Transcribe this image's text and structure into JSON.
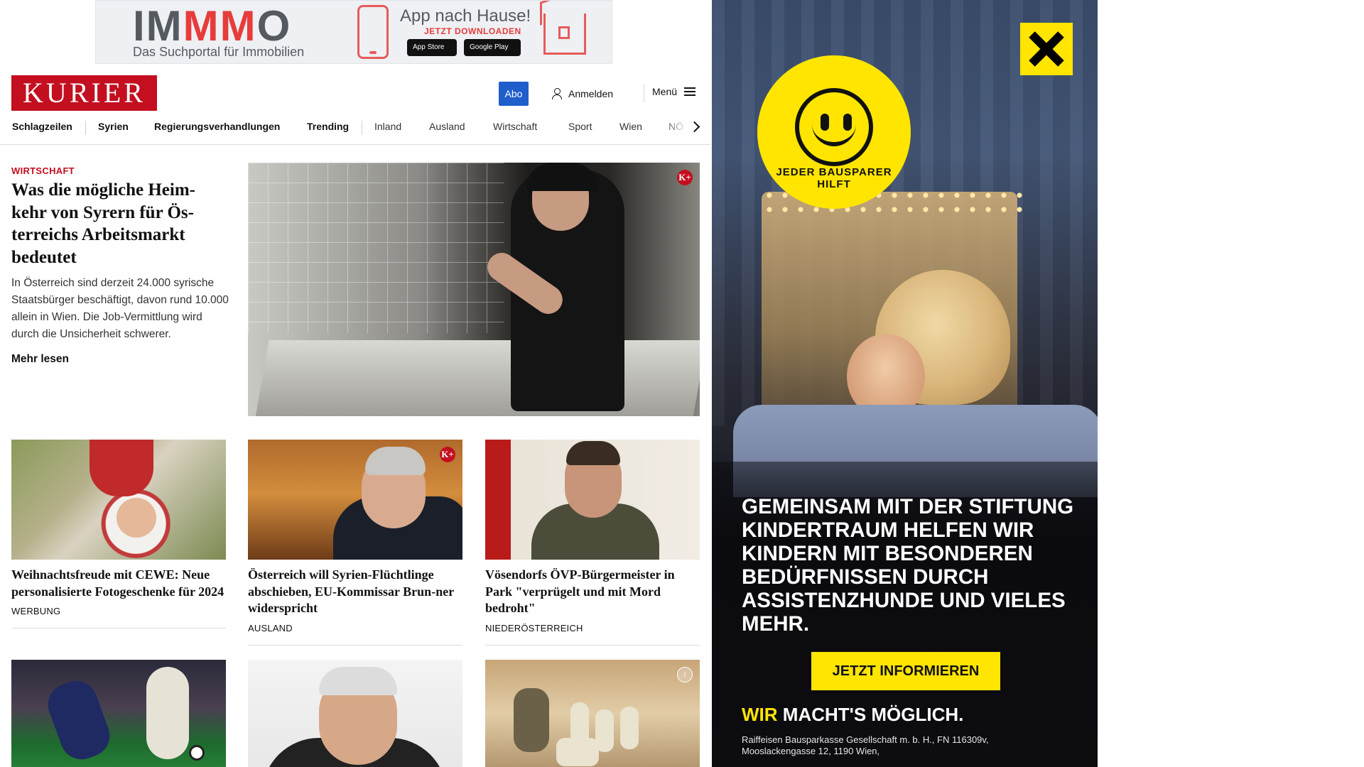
{
  "top_ad": {
    "logo_left": "IM",
    "logo_mid": "MM",
    "logo_right": "O",
    "tagline": "Das Suchportal für Immobilien",
    "headline": "App nach Hause!",
    "subline": "JETZT DOWNLOADEN",
    "app_store_label": "App Store",
    "google_play_label": "Google Play"
  },
  "header": {
    "logo": "KURIER",
    "abo": "Abo",
    "login": "Anmelden",
    "menu": "Menü"
  },
  "nav": {
    "items": [
      "Schlagzeilen",
      "Syrien",
      "Regierungsverhandlungen",
      "Trending",
      "Inland",
      "Ausland",
      "Wirtschaft",
      "Sport",
      "Wien",
      "NÖ"
    ]
  },
  "lead": {
    "category": "WIRTSCHAFT",
    "title": "Was die mögliche Heim-kehr von Syrern für Ös-terreichs Arbeitsmarkt bedeutet",
    "summary": "In Österreich sind derzeit 24.000 syrische Staatsbürger beschäftigt, davon rund 10.000 allein in Wien. Die Job-Vermittlung wird durch die Unsicherheit schwerer.",
    "more": "Mehr lesen",
    "badge": "K+"
  },
  "articles": [
    {
      "title": "Weihnachtsfreude mit CEWE: Neue personalisierte Fotogeschenke für 2024",
      "category": "WERBUNG"
    },
    {
      "title": "Österreich will Syrien-Flüchtlinge abschieben, EU-Kommissar Brun-ner widerspricht",
      "category": "AUSLAND",
      "badge": "K+"
    },
    {
      "title": "Vösendorfs ÖVP-Bürgermeister in Park \"verprügelt und mit Mord bedroht\"",
      "category": "NIEDERÖSTERREICH"
    }
  ],
  "side_ad": {
    "badge_text": "JEDER BAUSPARER HILFT",
    "headline": "GEMEINSAM MIT DER STIFTUNG KINDERTRAUM HELFEN WIR KINDERN MIT BESONDEREN BEDÜRFNISSEN DURCH ASSISTENZHUNDE UND VIELES MEHR.",
    "cta": "JETZT INFORMIEREN",
    "slogan_wir": "WIR",
    "slogan_rest": "MACHT'S MÖGLICH.",
    "legal": "Raiffeisen Bausparkasse Gesellschaft m. b. H., FN 116309v, Mooslackengasse 12, 1190 Wien,",
    "brand_color": "#ffe500"
  },
  "colors": {
    "kurier_red": "#c30f1f",
    "abo_blue": "#1f5ecb"
  }
}
